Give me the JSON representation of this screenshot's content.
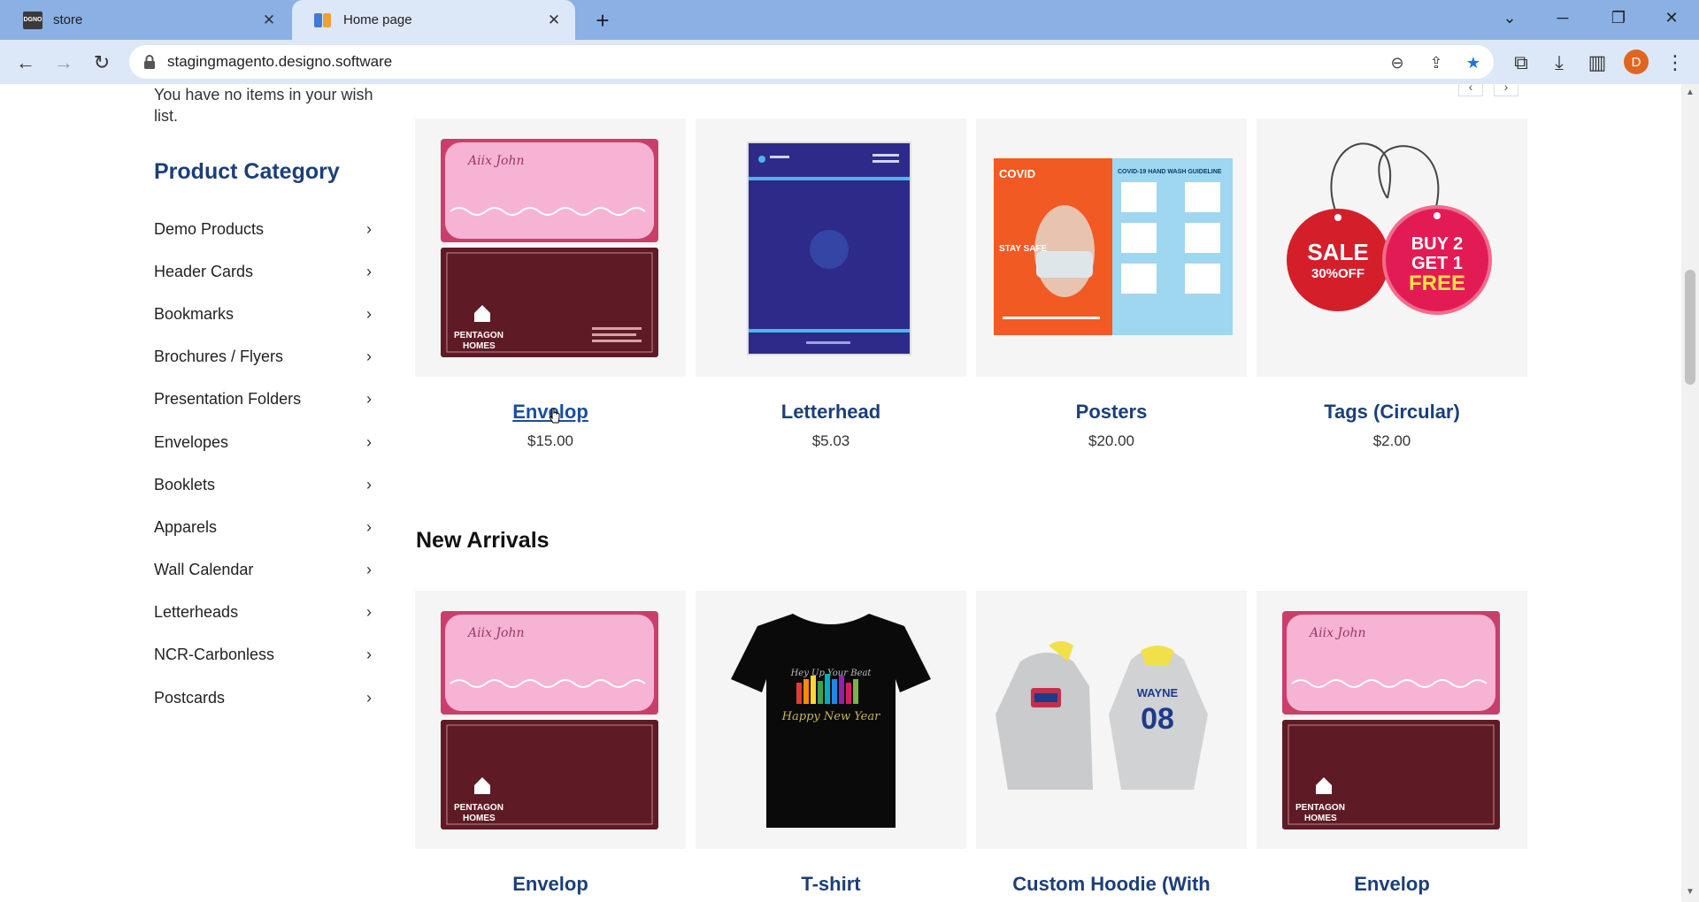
{
  "browser": {
    "tabs": [
      {
        "title": "store",
        "favicon": "store-favicon",
        "favicon_text": "DGNO"
      },
      {
        "title": "Home page",
        "favicon": "designo-favicon"
      }
    ],
    "url": "stagingmagento.designo.software",
    "profile_initial": "D"
  },
  "sidebar": {
    "wishlist_message": "You have no items in your wish list.",
    "title": "Product Category",
    "categories": [
      "Demo Products",
      "Header Cards",
      "Bookmarks",
      "Brochures / Flyers",
      "Presentation Folders",
      "Envelopes",
      "Booklets",
      "Apparels",
      "Wall Calendar",
      "Letterheads",
      "NCR-Carbonless",
      "Postcards"
    ]
  },
  "featured_products": [
    {
      "name": "Envelop",
      "price": "$15.00",
      "image": "envelope-image"
    },
    {
      "name": "Letterhead",
      "price": "$5.03",
      "image": "letterhead-image"
    },
    {
      "name": "Posters",
      "price": "$20.00",
      "image": "poster-image"
    },
    {
      "name": "Tags (Circular)",
      "price": "$2.00",
      "image": "sale-tags-image"
    }
  ],
  "new_arrivals": {
    "title": "New Arrivals",
    "products": [
      {
        "name": "Envelop",
        "image": "envelope-image"
      },
      {
        "name": "T-shirt",
        "image": "tshirt-image"
      },
      {
        "name": "Custom Hoodie (With",
        "image": "hoodie-image"
      },
      {
        "name": "Envelop",
        "image": "envelope-image"
      }
    ]
  },
  "product_image_text": {
    "envelope_script": "Aiix John",
    "envelope_brand_line1": "PENTAGON",
    "envelope_brand_line2": "HOMES",
    "poster_heading": "COVID",
    "poster_right_heading": "COVID-19 HAND WASH GUIDELINE",
    "poster_stay_safe": "STAY SAFE",
    "tag_sale": "SALE",
    "tag_sale_off": "30%OFF",
    "tag_buy": "BUY 2",
    "tag_get": "GET 1",
    "tag_free": "FREE",
    "tshirt_line1": "Hey Up Your Beat",
    "tshirt_line2": "Happy New Year",
    "hoodie_name": "WAYNE",
    "hoodie_number": "08"
  },
  "colors": {
    "accent": "#1c3f78",
    "link": "#1a4f9c",
    "chrome_tabstrip": "#8ab0e4",
    "chrome_toolbar": "#dce7f7",
    "bookmark_star": "#1a73e8",
    "profile": "#e0661f"
  }
}
